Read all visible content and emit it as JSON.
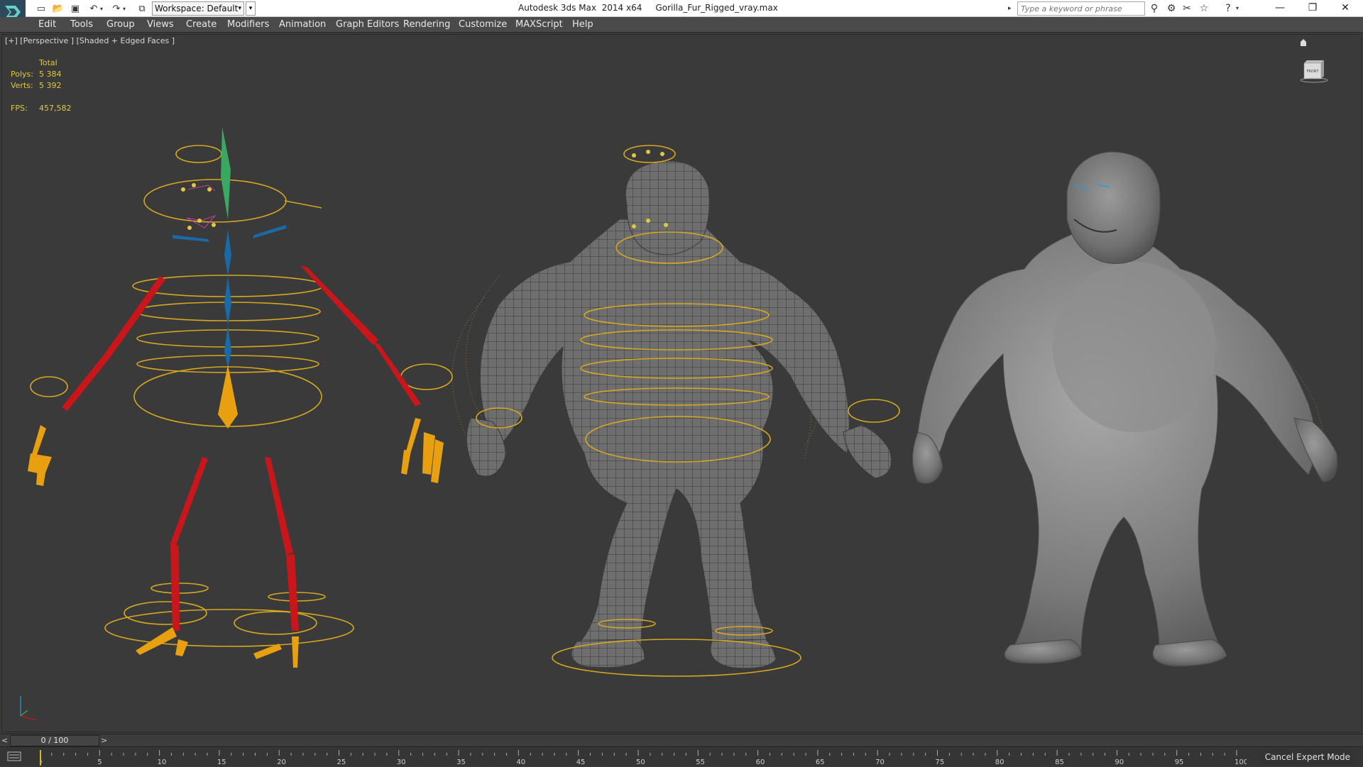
{
  "app": {
    "title": "Autodesk 3ds Max  2014 x64     Gorilla_Fur_Rigged_vray.max",
    "workspace_label": "Workspace: Default",
    "search_placeholder": "Type a keyword or phrase"
  },
  "menu": [
    "Edit",
    "Tools",
    "Group",
    "Views",
    "Create",
    "Modifiers",
    "Animation",
    "Graph Editors",
    "Rendering",
    "Customize",
    "MAXScript",
    "Help"
  ],
  "viewport": {
    "label": "[+] [Perspective ] [Shaded + Edged Faces ]",
    "stats": {
      "total_label": "Total",
      "polys_label": "Polys:",
      "polys_value": "5 384",
      "verts_label": "Verts:",
      "verts_value": "5 392",
      "fps_label": "FPS:",
      "fps_value": "457,582"
    },
    "viewcube_label": "FRONT"
  },
  "timeline": {
    "frame_display": "0 / 100",
    "current_frame": 0,
    "start": 0,
    "end": 100,
    "ticks": [
      "0",
      "5",
      "10",
      "15",
      "20",
      "25",
      "30",
      "35",
      "40",
      "45",
      "50",
      "55",
      "60",
      "65",
      "70",
      "75",
      "80",
      "85",
      "90",
      "95",
      "100"
    ],
    "expert_label": "Cancel Expert Mode"
  },
  "colors": {
    "accent_yellow": "#e0c843",
    "viewport_bg": "#3a3a3a",
    "bone_red": "#c8161a",
    "bone_blue": "#1a6aa8",
    "bone_orange": "#e8a010",
    "bone_green": "#3aa860"
  }
}
